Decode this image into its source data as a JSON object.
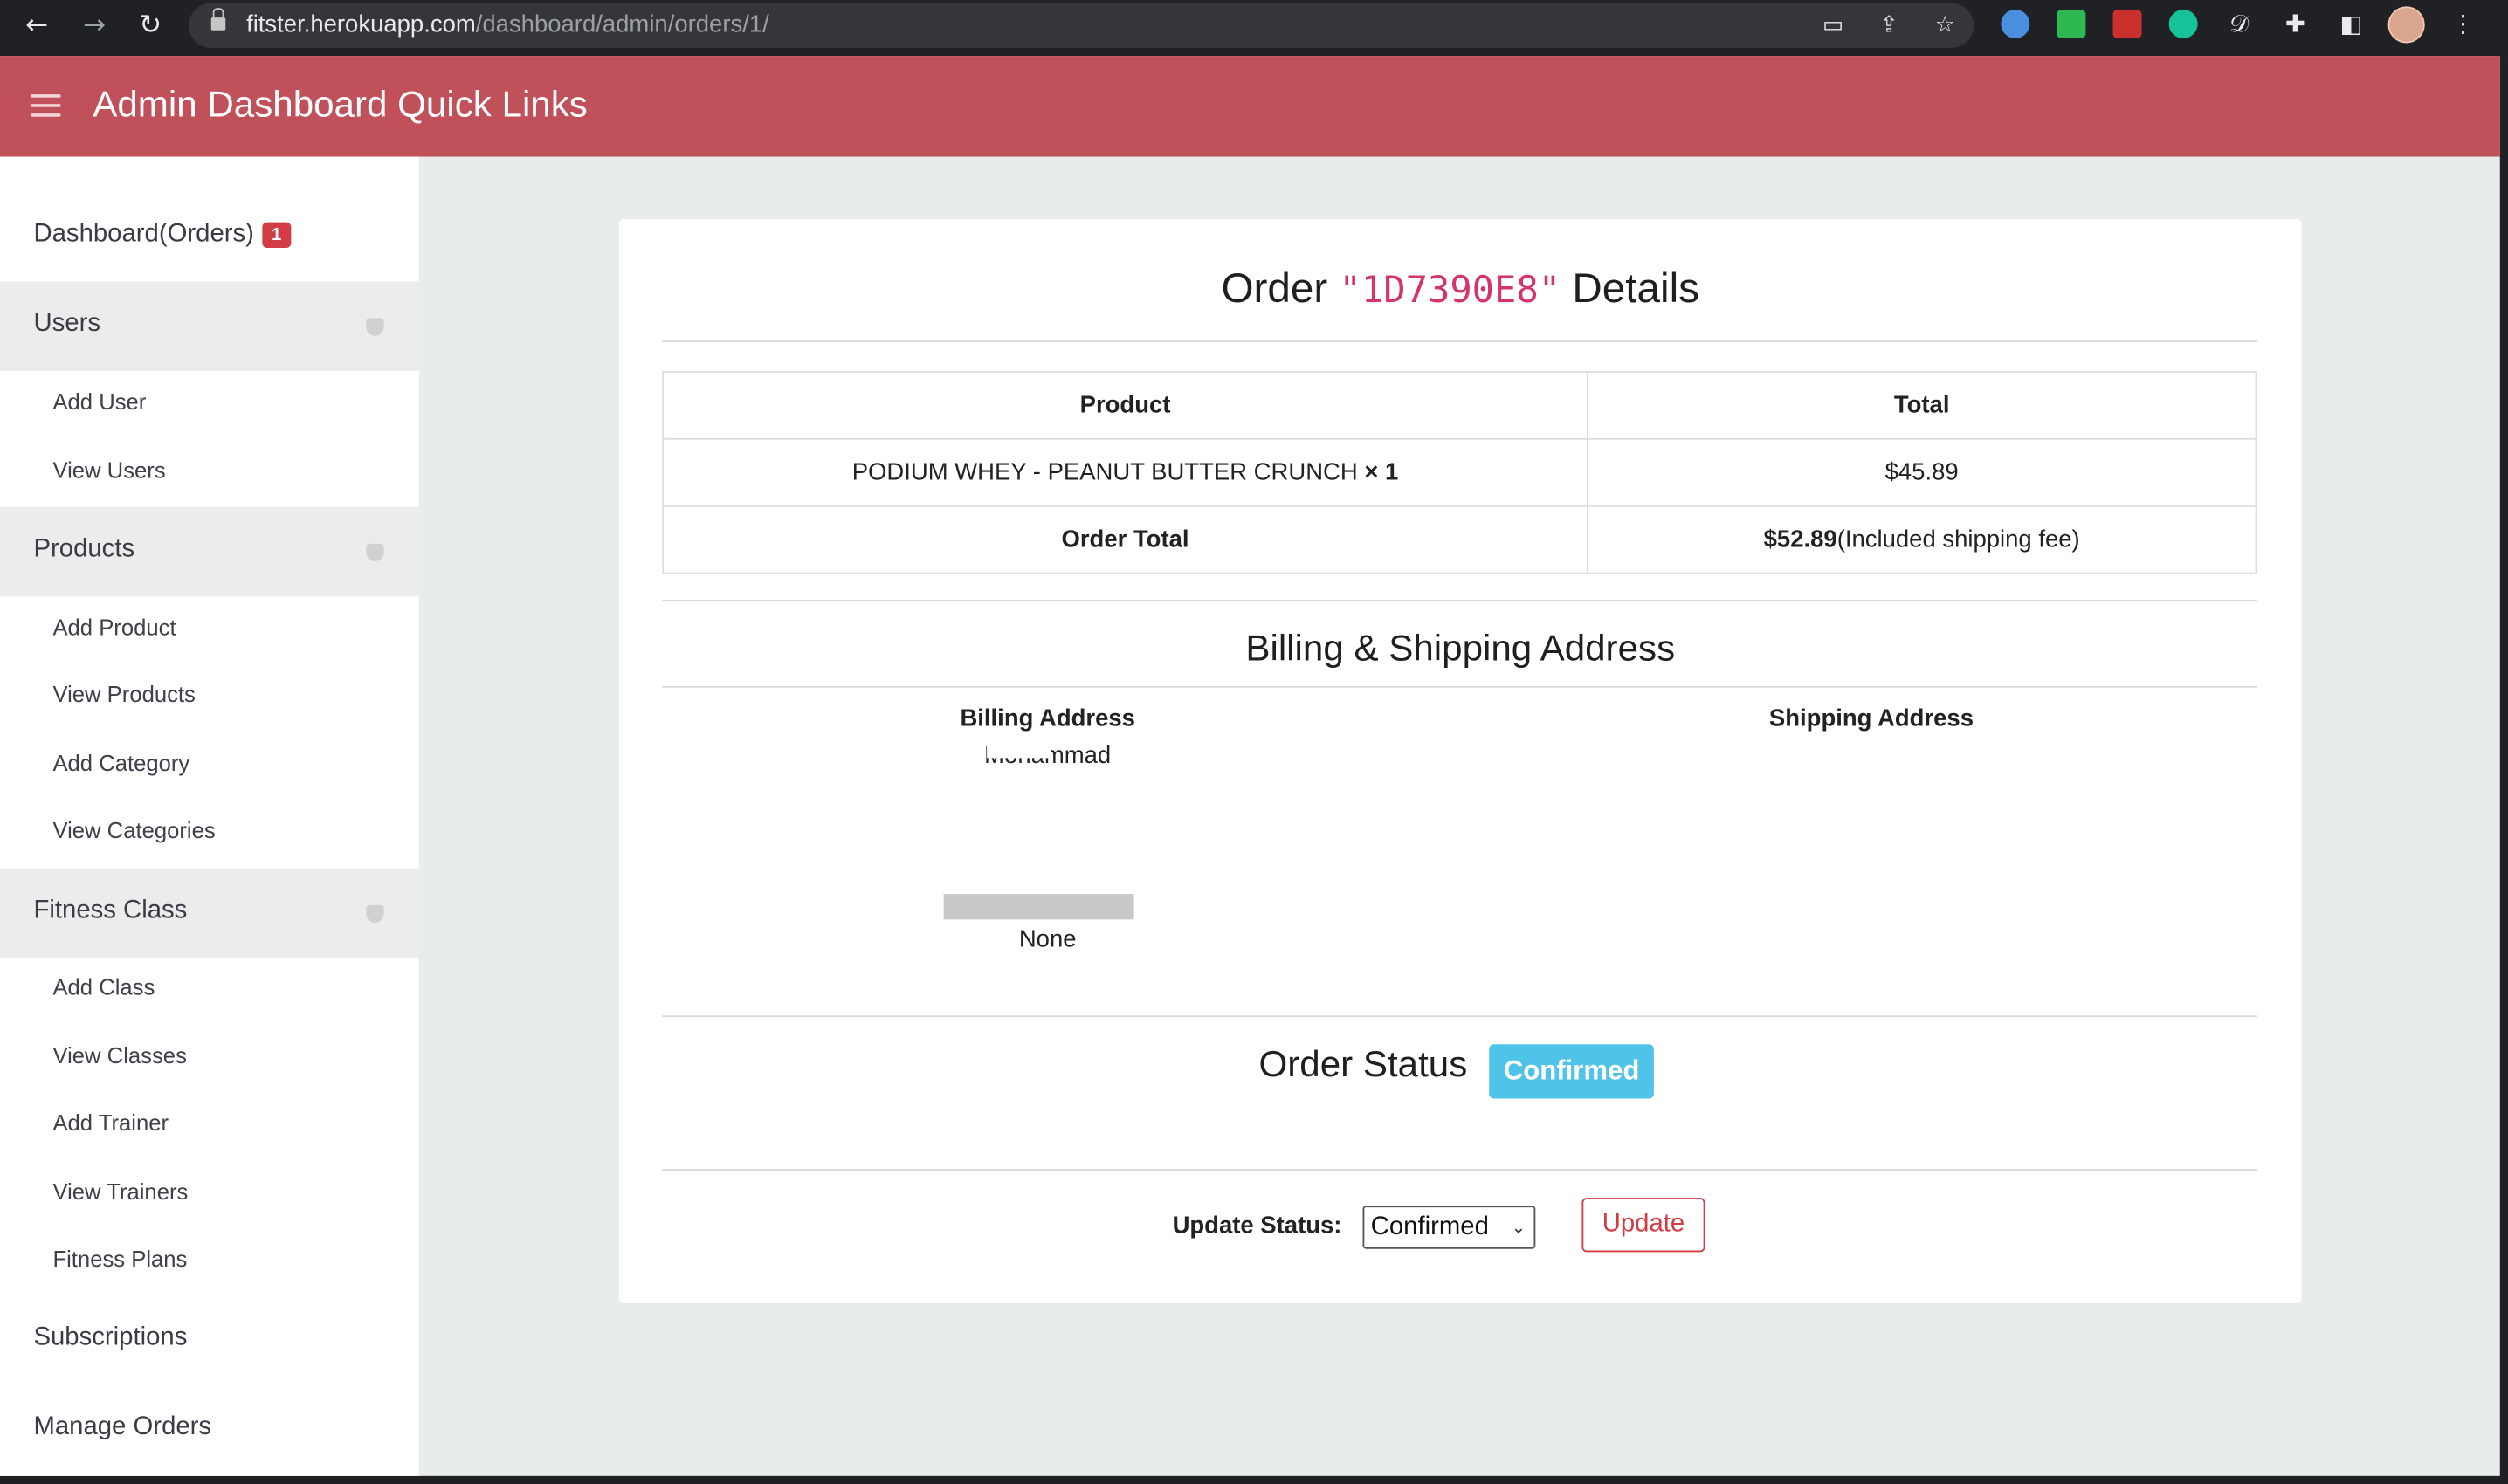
{
  "browser": {
    "url_host": "fitster.herokuapp.com",
    "url_path": "/dashboard/admin/orders/1/"
  },
  "topbar": {
    "title": "Admin Dashboard Quick Links",
    "accent_color": "#c0505a"
  },
  "sidebar": {
    "dashboard_label": "Dashboard(Orders)",
    "dashboard_badge": "1",
    "groups": [
      {
        "label": "Users",
        "items": [
          "Add User",
          "View Users"
        ]
      },
      {
        "label": "Products",
        "items": [
          "Add Product",
          "View Products",
          "Add Category",
          "View Categories"
        ]
      },
      {
        "label": "Fitness Class",
        "items": [
          "Add Class",
          "View Classes",
          "Add Trainer",
          "View Trainers",
          "Fitness Plans"
        ]
      }
    ],
    "subscriptions_label": "Subscriptions",
    "manage_orders_label": "Manage Orders"
  },
  "order": {
    "title_prefix": "Order",
    "code": "\"1D7390E8\"",
    "title_suffix": "Details",
    "table": {
      "headers": [
        "Product",
        "Total"
      ],
      "product_name": "PODIUM WHEY - PEANUT BUTTER CRUNCH",
      "product_qty": "× 1",
      "product_total": "$45.89",
      "order_total_label": "Order Total",
      "order_total_value": "$52.89",
      "order_total_note": "(Included shipping fee)"
    },
    "address_section_title": "Billing & Shipping Address",
    "billing_label": "Billing Address",
    "shipping_label": "Shipping Address",
    "billing_lines": [
      "Mohammad",
      "",
      "",
      "None"
    ],
    "status_title": "Order Status",
    "status_badge": "Confirmed",
    "update_status_label": "Update Status:",
    "status_select_value": "Confirmed",
    "update_button": "Update"
  }
}
